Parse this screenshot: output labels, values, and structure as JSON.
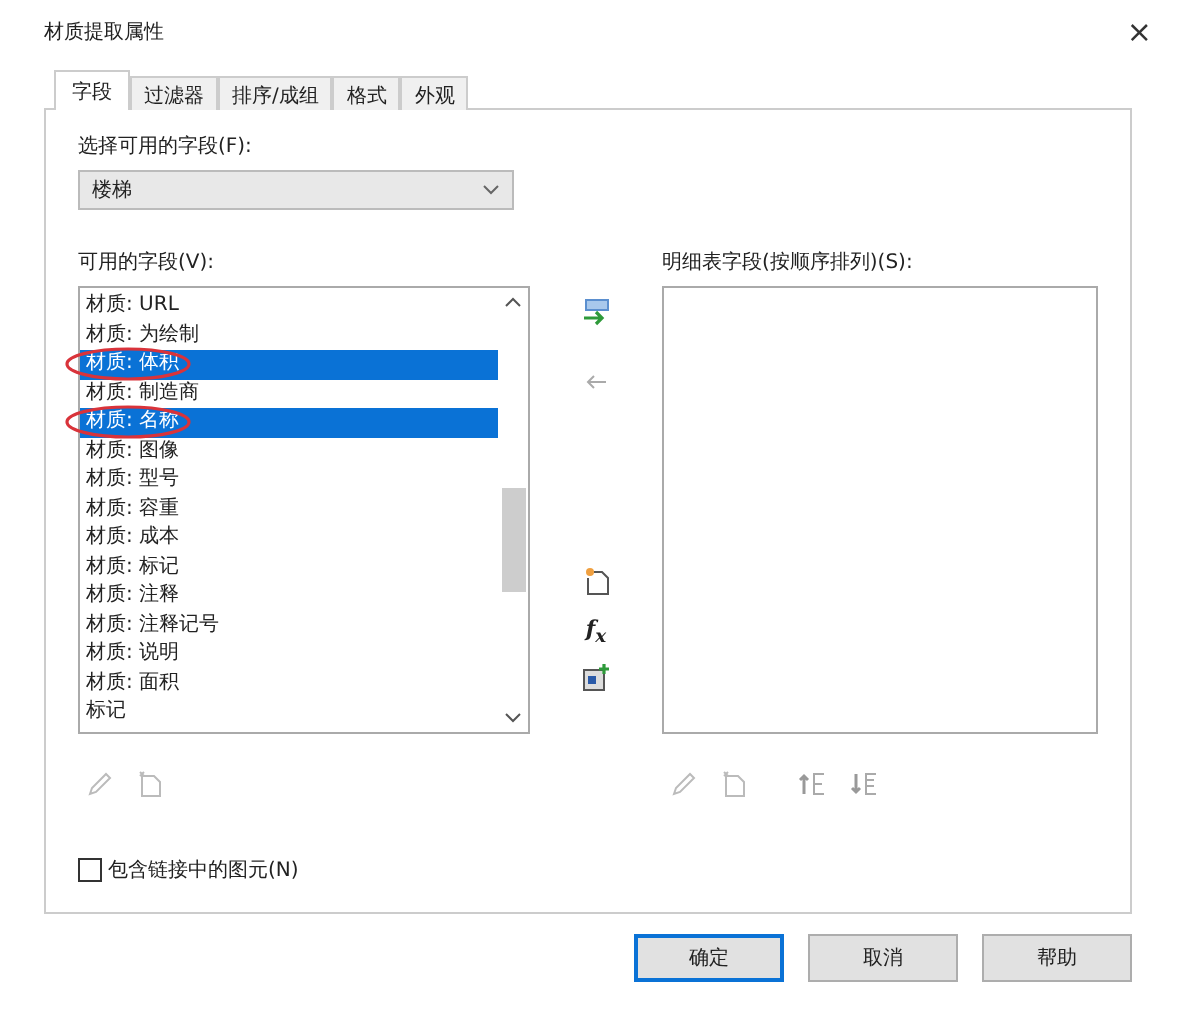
{
  "window": {
    "title": "材质提取属性",
    "close": "×"
  },
  "tabs": [
    {
      "label": "字段",
      "selected": true
    },
    {
      "label": "过滤器",
      "selected": false
    },
    {
      "label": "排序/成组",
      "selected": false
    },
    {
      "label": "格式",
      "selected": false
    },
    {
      "label": "外观",
      "selected": false
    }
  ],
  "category_select": {
    "label": "选择可用的字段(F):",
    "value": "楼梯"
  },
  "available_fields": {
    "label": "可用的字段(V):",
    "items": [
      {
        "label": "材质: URL",
        "selected": false,
        "circled": false
      },
      {
        "label": "材质: 为绘制",
        "selected": false,
        "circled": false
      },
      {
        "label": "材质: 体积",
        "selected": true,
        "circled": true
      },
      {
        "label": "材质: 制造商",
        "selected": false,
        "circled": false
      },
      {
        "label": "材质: 名称",
        "selected": true,
        "circled": true
      },
      {
        "label": "材质: 图像",
        "selected": false,
        "circled": false
      },
      {
        "label": "材质: 型号",
        "selected": false,
        "circled": false
      },
      {
        "label": "材质: 容重",
        "selected": false,
        "circled": false
      },
      {
        "label": "材质: 成本",
        "selected": false,
        "circled": false
      },
      {
        "label": "材质: 标记",
        "selected": false,
        "circled": false
      },
      {
        "label": "材质: 注释",
        "selected": false,
        "circled": false
      },
      {
        "label": "材质: 注释记号",
        "selected": false,
        "circled": false
      },
      {
        "label": "材质: 说明",
        "selected": false,
        "circled": false
      },
      {
        "label": "材质: 面积",
        "selected": false,
        "circled": false
      },
      {
        "label": "标记",
        "selected": false,
        "circled": false
      }
    ]
  },
  "schedule_fields": {
    "label": "明细表字段(按顺序排列)(S):"
  },
  "formula_button": {
    "label": "f$_{x}$"
  },
  "include_linked": {
    "label": "包含链接中的图元(N)",
    "checked": false
  },
  "buttons": [
    {
      "label": "确定",
      "default": true
    },
    {
      "label": "取消",
      "default": false
    },
    {
      "label": "帮助",
      "default": false
    }
  ]
}
